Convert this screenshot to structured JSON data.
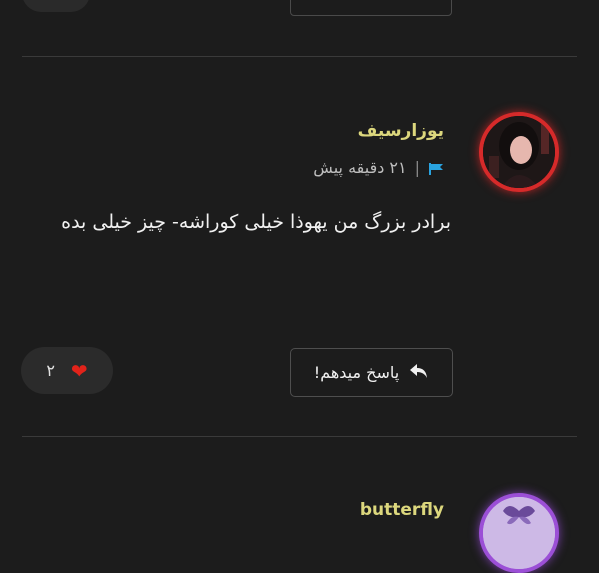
{
  "comments": [
    {
      "username": "یوزارسیف",
      "time_ago": "۲۱ دقیقه پیش",
      "text": "برادر بزرگ من یهوذا خیلی کوراشه- چیز خیلی بده",
      "reply_label": "پاسخ میدهم!",
      "like_count": "۲",
      "avatar_ring_color": "#d62a2a"
    },
    {
      "username": "butterfly",
      "avatar_ring_color": "#9b4fd6"
    }
  ],
  "colors": {
    "background": "#1c1c1c",
    "username": "#dcd77d",
    "flag": "#29a3e0",
    "heart": "#e2231a"
  }
}
